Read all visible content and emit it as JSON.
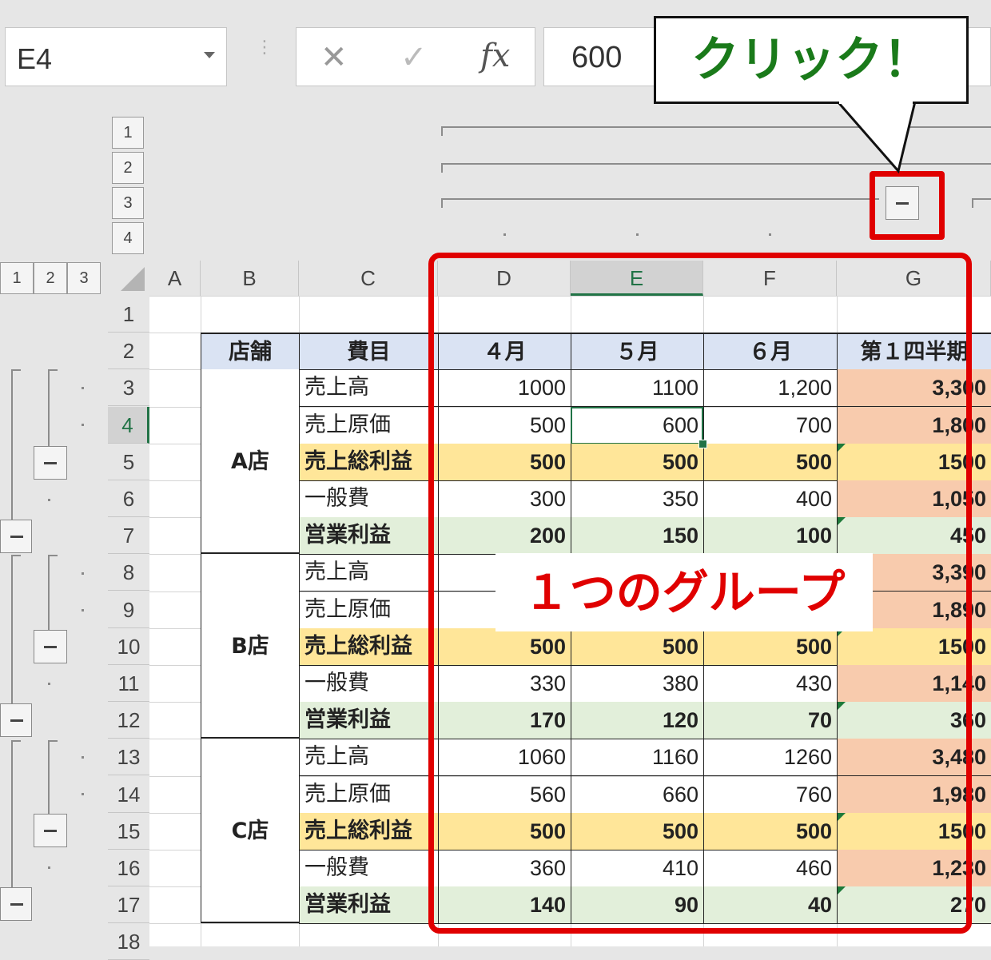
{
  "name_box": "E4",
  "formula_buttons": {
    "cancel": "✕",
    "enter": "✓",
    "function": "fx"
  },
  "formula_value": "600",
  "callout_click": "クリック！",
  "callout_group": "１つのグループ",
  "column_outline_levels": [
    "1",
    "2",
    "3",
    "4"
  ],
  "row_outline_levels": [
    "1",
    "2",
    "3"
  ],
  "columns": [
    "A",
    "B",
    "C",
    "D",
    "E",
    "F",
    "G"
  ],
  "rows": [
    "1",
    "2",
    "3",
    "4",
    "5",
    "6",
    "7",
    "8",
    "9",
    "10",
    "11",
    "12",
    "13",
    "14",
    "15",
    "16",
    "17",
    "18"
  ],
  "selected_cell": "E4",
  "table": {
    "headers": [
      "店舗",
      "費目",
      "４月",
      "５月",
      "６月",
      "第１四半期"
    ],
    "stores": [
      "A店",
      "B店",
      "C店"
    ],
    "rows": [
      [
        "売上高",
        "1000",
        "1100",
        "1,200",
        "3,300"
      ],
      [
        "売上原価",
        "500",
        "600",
        "700",
        "1,800"
      ],
      [
        "売上総利益",
        "500",
        "500",
        "500",
        "1500"
      ],
      [
        "一般費",
        "300",
        "350",
        "400",
        "1,050"
      ],
      [
        "営業利益",
        "200",
        "150",
        "100",
        "450"
      ],
      [
        "売上高",
        "",
        "",
        "",
        "3,390"
      ],
      [
        "売上原価",
        "",
        "",
        "",
        "1,890"
      ],
      [
        "売上総利益",
        "500",
        "500",
        "500",
        "1500"
      ],
      [
        "一般費",
        "330",
        "380",
        "430",
        "1,140"
      ],
      [
        "営業利益",
        "170",
        "120",
        "70",
        "360"
      ],
      [
        "売上高",
        "1060",
        "1160",
        "1260",
        "3,480"
      ],
      [
        "売上原価",
        "560",
        "660",
        "760",
        "1,980"
      ],
      [
        "売上総利益",
        "500",
        "500",
        "500",
        "1500"
      ],
      [
        "一般費",
        "360",
        "410",
        "460",
        "1,230"
      ],
      [
        "営業利益",
        "140",
        "90",
        "40",
        "270"
      ]
    ]
  },
  "colors": {
    "header_fill": "#dae3f3",
    "gross_profit_fill": "#ffe699",
    "operating_profit_fill": "#e2efda",
    "quarter_fill": "#f8cbad",
    "highlight_red": "#e00000",
    "click_text": "#1a7a1a",
    "selection_green": "#217346"
  }
}
